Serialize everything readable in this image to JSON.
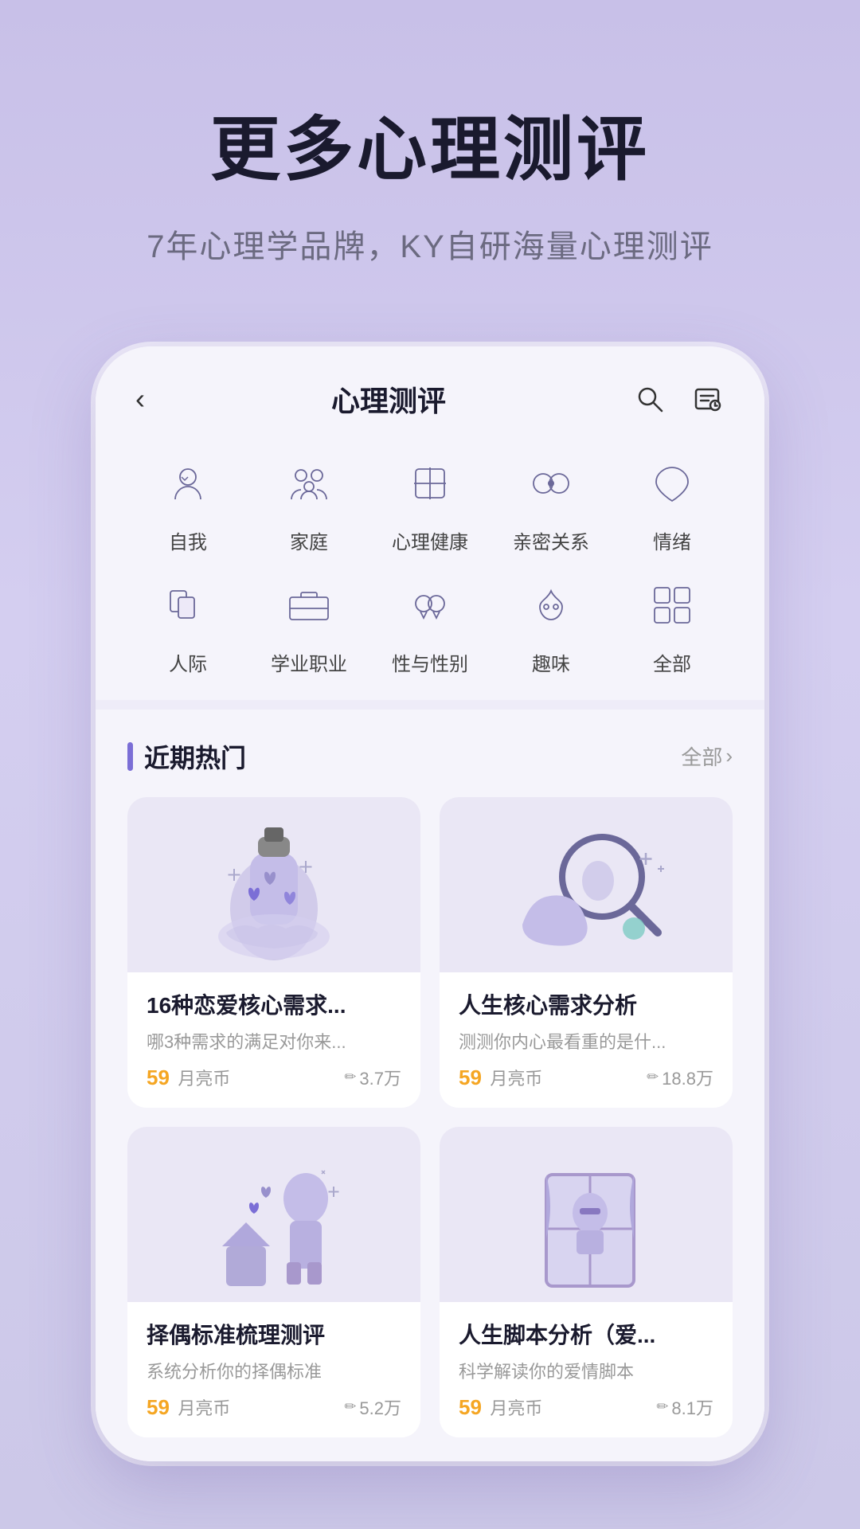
{
  "hero": {
    "title": "更多心理测评",
    "subtitle": "7年心理学品牌，KY自研海量心理测评"
  },
  "nav": {
    "back_label": "‹",
    "title": "心理测评",
    "search_icon": "search",
    "history_icon": "history"
  },
  "categories": [
    {
      "id": "self",
      "label": "自我",
      "icon": "self"
    },
    {
      "id": "family",
      "label": "家庭",
      "icon": "family"
    },
    {
      "id": "mental-health",
      "label": "心理健康",
      "icon": "mental-health"
    },
    {
      "id": "relationship",
      "label": "亲密关系",
      "icon": "relationship"
    },
    {
      "id": "emotion",
      "label": "情绪",
      "icon": "emotion"
    },
    {
      "id": "interpersonal",
      "label": "人际",
      "icon": "interpersonal"
    },
    {
      "id": "career",
      "label": "学业职业",
      "icon": "career"
    },
    {
      "id": "gender",
      "label": "性与性别",
      "icon": "gender"
    },
    {
      "id": "interest",
      "label": "趣味",
      "icon": "interest"
    },
    {
      "id": "all",
      "label": "全部",
      "icon": "grid"
    }
  ],
  "hot_section": {
    "title": "近期热门",
    "all_label": "全部",
    "chevron": "›"
  },
  "cards": [
    {
      "id": "card1",
      "title": "16种恋爱核心需求...",
      "desc": "哪3种需求的满足对你来...",
      "price": "59",
      "price_unit": "月亮币",
      "count": "3.7万",
      "color": "#e8e4f4"
    },
    {
      "id": "card2",
      "title": "人生核心需求分析",
      "desc": "测测你内心最看重的是什...",
      "price": "59",
      "price_unit": "月亮币",
      "count": "18.8万",
      "color": "#e8e4f4"
    },
    {
      "id": "card3",
      "title": "择偶标准梳理测评",
      "desc": "系统分析你的择偶标准",
      "price": "59",
      "price_unit": "月亮币",
      "count": "5.2万",
      "color": "#e8e4f4"
    },
    {
      "id": "card4",
      "title": "人生脚本分析（爱...",
      "desc": "科学解读你的爱情脚本",
      "price": "59",
      "price_unit": "月亮币",
      "count": "8.1万",
      "color": "#e8e4f4"
    }
  ]
}
